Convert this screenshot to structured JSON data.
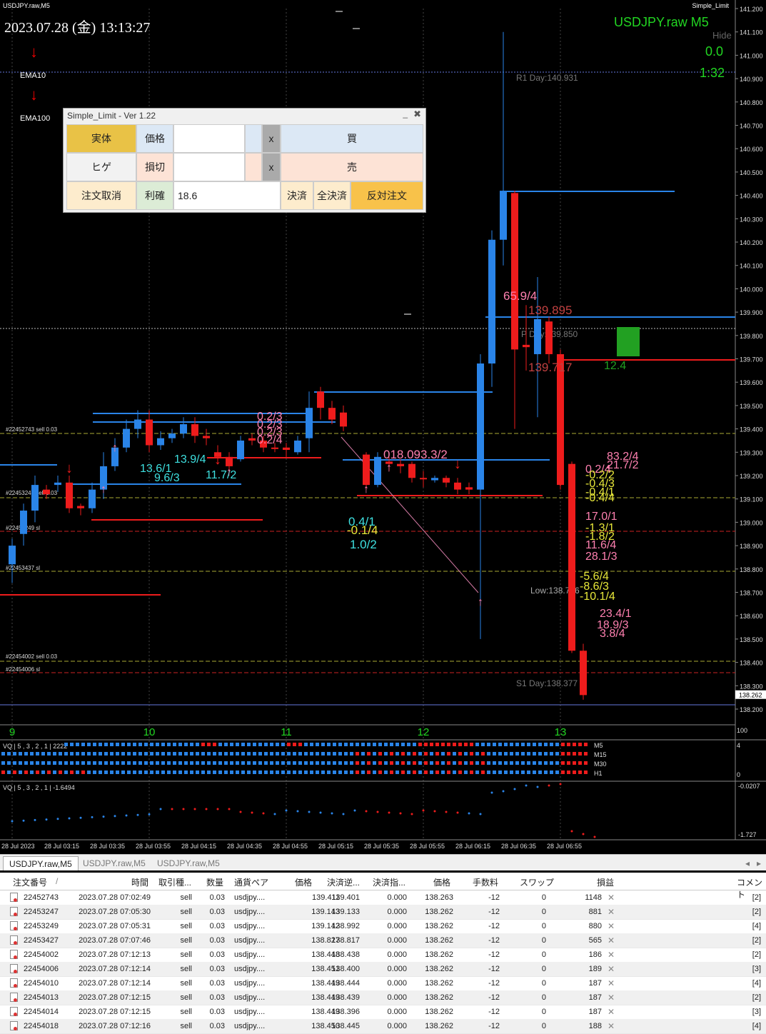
{
  "window": {
    "title": "USDJPY.raw,M5",
    "ea_label": "Simple_Limit"
  },
  "overlay": {
    "datetime": "2023.07.28 (金) 13:13:27",
    "symbol_tf": "USDJPY.raw  M5",
    "hide": "Hide",
    "spread": "0.0",
    "timer": "1:32",
    "ema10": "EMA10",
    "ema100": "EMA100"
  },
  "panel": {
    "title": "Simple_Limit - Ver 1.22",
    "body_label": "実体",
    "wick_label": "ヒゲ",
    "price_label": "価格",
    "stoploss_label": "損切",
    "takeprofit_label": "利確",
    "takeprofit_value": "18.6",
    "price_value": "",
    "stoploss_value": "",
    "x1": "x",
    "x2": "x",
    "buy": "買",
    "sell": "売",
    "cancel_orders": "注文取消",
    "close": "決済",
    "close_all": "全決済",
    "reverse": "反対注文",
    "colors": {
      "body_bg": "#e9c246",
      "buy_bg": "#dce8f5",
      "sell_bg": "#fde3d6",
      "takeprofit_bg": "#dcecd6",
      "reverse_bg": "#f8c24a",
      "cancel_bg": "#fdeccd"
    }
  },
  "price_axis": {
    "ticks": [
      "141.200",
      "141.100",
      "141.000",
      "140.900",
      "140.800",
      "140.700",
      "140.600",
      "140.500",
      "140.400",
      "140.300",
      "140.200",
      "140.100",
      "140.000",
      "139.900",
      "139.800",
      "139.700",
      "139.600",
      "139.500",
      "139.400",
      "139.300",
      "139.200",
      "139.100",
      "139.000",
      "138.900",
      "138.800",
      "138.700",
      "138.600",
      "138.500",
      "138.400",
      "138.300",
      "138.200"
    ],
    "current_price": "138.262"
  },
  "hour_labels": [
    "9",
    "10",
    "11",
    "12",
    "13"
  ],
  "pivots": {
    "r1": "R1 Day:140.931",
    "p": "P Day:139.850",
    "s1": "S1 Day:138.377",
    "low": "Low:138.766"
  },
  "price_labels": {
    "high_marker": "139.895",
    "low_marker": "139.717",
    "pips_up": "65.9/4",
    "pips_box": "12.4"
  },
  "annotations": {
    "pink_left": [
      "0.2/3",
      "0.2/3",
      "0.2/3",
      "0.2/4"
    ],
    "cyan_left": [
      "13.6/1",
      "13.9/4",
      "9.6/3",
      "11.7/2"
    ],
    "mid": [
      "0.4/1",
      "-0.1/4",
      "1.0/2"
    ],
    "mid_pink": [
      "018.093.3/2"
    ],
    "right_pink": [
      "83.2/4",
      "21.7/2",
      "0.2/4",
      "17.0/1",
      "11.6/4",
      "28.1/3",
      "23.4/1",
      "18.9/3",
      "3.8/4"
    ],
    "right_yellow": [
      "-0.2/2",
      "-0.4/3",
      "-0.4/1",
      "-0.4/4",
      "-1.3/1",
      "-1.8/2",
      "-5.6/4",
      "-8.6/3",
      "-10.1/4"
    ]
  },
  "order_tags": [
    "#22452743 sell 0.03",
    "#22453247 sell 0.03",
    "#22453249 sl",
    "#22453437 sl",
    "#22454002 sell 0.03",
    "#22454006 sl"
  ],
  "indicator1": {
    "label": "VQ | 5 , 3 , 2 , 1 | 2222",
    "rows": [
      "M5",
      "M15",
      "M30",
      "H1"
    ],
    "axis_top": "4",
    "axis_bottom": "0",
    "axis_100": "100"
  },
  "indicator2": {
    "label": "VQ | 5 , 3 , 2 , 1 | -1.6494",
    "axis_top": "-0.0207",
    "axis_bottom": "-1.727"
  },
  "time_axis": [
    "28 Jul 2023",
    "28 Jul 03:15",
    "28 Jul 03:35",
    "28 Jul 03:55",
    "28 Jul 04:15",
    "28 Jul 04:35",
    "28 Jul 04:55",
    "28 Jul 05:15",
    "28 Jul 05:35",
    "28 Jul 05:55",
    "28 Jul 06:15",
    "28 Jul 06:35",
    "28 Jul 06:55"
  ],
  "tabs": [
    "USDJPY.raw,M5",
    "USDJPY.raw,M5",
    "USDJPY.raw,M5"
  ],
  "table": {
    "headers": [
      "注文番号",
      "/",
      "時間",
      "取引種...",
      "数量",
      "通貨ペア",
      "価格",
      "決済逆...",
      "決済指...",
      "価格",
      "手数料",
      "スワップ",
      "損益",
      "コメント"
    ],
    "rows": [
      [
        "22452743",
        "2023.07.28 07:02:49",
        "sell",
        "0.03",
        "usdjpy....",
        "139.411",
        "139.401",
        "0.000",
        "138.263",
        "-12",
        "0",
        "1148",
        "[2]"
      ],
      [
        "22453247",
        "2023.07.28 07:05:30",
        "sell",
        "0.03",
        "usdjpy....",
        "139.143",
        "139.133",
        "0.000",
        "138.262",
        "-12",
        "0",
        "881",
        "[2]"
      ],
      [
        "22453249",
        "2023.07.28 07:05:31",
        "sell",
        "0.03",
        "usdjpy....",
        "139.142",
        "138.992",
        "0.000",
        "138.262",
        "-12",
        "0",
        "880",
        "[4]"
      ],
      [
        "22453427",
        "2023.07.28 07:07:46",
        "sell",
        "0.03",
        "usdjpy....",
        "138.827",
        "138.817",
        "0.000",
        "138.262",
        "-12",
        "0",
        "565",
        "[2]"
      ],
      [
        "22454002",
        "2023.07.28 07:12:13",
        "sell",
        "0.03",
        "usdjpy....",
        "138.448",
        "138.438",
        "0.000",
        "138.262",
        "-12",
        "0",
        "186",
        "[2]"
      ],
      [
        "22454006",
        "2023.07.28 07:12:14",
        "sell",
        "0.03",
        "usdjpy....",
        "138.451",
        "138.400",
        "0.000",
        "138.262",
        "-12",
        "0",
        "189",
        "[3]"
      ],
      [
        "22454010",
        "2023.07.28 07:12:14",
        "sell",
        "0.03",
        "usdjpy....",
        "138.449",
        "138.444",
        "0.000",
        "138.262",
        "-12",
        "0",
        "187",
        "[4]"
      ],
      [
        "22454013",
        "2023.07.28 07:12:15",
        "sell",
        "0.03",
        "usdjpy....",
        "138.449",
        "138.439",
        "0.000",
        "138.262",
        "-12",
        "0",
        "187",
        "[2]"
      ],
      [
        "22454014",
        "2023.07.28 07:12:15",
        "sell",
        "0.03",
        "usdjpy....",
        "138.449",
        "138.396",
        "0.000",
        "138.262",
        "-12",
        "0",
        "187",
        "[3]"
      ],
      [
        "22454018",
        "2023.07.28 07:12:16",
        "sell",
        "0.03",
        "usdjpy....",
        "138.450",
        "138.445",
        "0.000",
        "138.262",
        "-12",
        "0",
        "188",
        "[4]"
      ]
    ]
  },
  "colors": {
    "bull": "#2a84e8",
    "bear": "#ee1c1c",
    "bg": "#000000",
    "grid": "#555555",
    "text_green": "#22d622"
  }
}
